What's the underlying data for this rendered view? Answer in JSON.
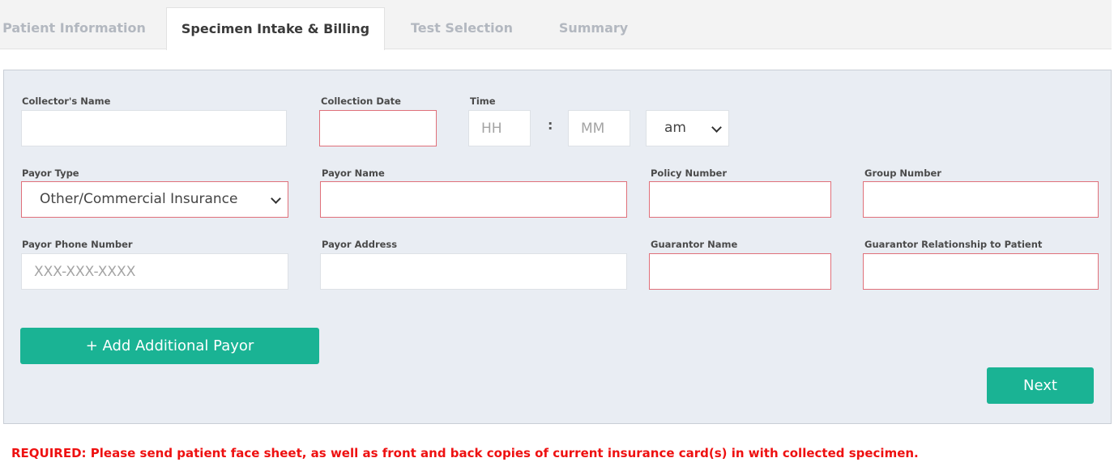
{
  "tabs": {
    "patient_info": "Patient Information",
    "specimen_billing": "Specimen Intake & Billing",
    "test_selection": "Test Selection",
    "summary": "Summary"
  },
  "form": {
    "collector_name": {
      "label": "Collector's Name",
      "value": "",
      "placeholder": ""
    },
    "collection_date": {
      "label": "Collection Date",
      "value": ""
    },
    "time": {
      "label": "Time",
      "hh_placeholder": "HH",
      "mm_placeholder": "MM",
      "separator": ":",
      "ampm_value": "am"
    },
    "payor_type": {
      "label": "Payor Type",
      "value": "Other/Commercial Insurance"
    },
    "payor_name": {
      "label": "Payor Name",
      "value": ""
    },
    "policy_number": {
      "label": "Policy Number",
      "value": ""
    },
    "group_number": {
      "label": "Group Number",
      "value": ""
    },
    "payor_phone": {
      "label": "Payor Phone Number",
      "value": "",
      "placeholder": "XXX-XXX-XXXX"
    },
    "payor_address": {
      "label": "Payor Address",
      "value": ""
    },
    "guarantor_name": {
      "label": "Guarantor Name",
      "value": ""
    },
    "guarantor_relationship": {
      "label": "Guarantor Relationship to Patient",
      "value": ""
    }
  },
  "buttons": {
    "add_payor": "+ Add Additional Payor",
    "next": "Next"
  },
  "notice": "REQUIRED: Please send patient face sheet, as well as front and back copies of current insurance card(s) in with collected specimen.",
  "colors": {
    "accent": "#1ab394",
    "required_border": "#e0707a",
    "notice_text": "#ee1111",
    "panel_bg": "#e9edf3"
  }
}
